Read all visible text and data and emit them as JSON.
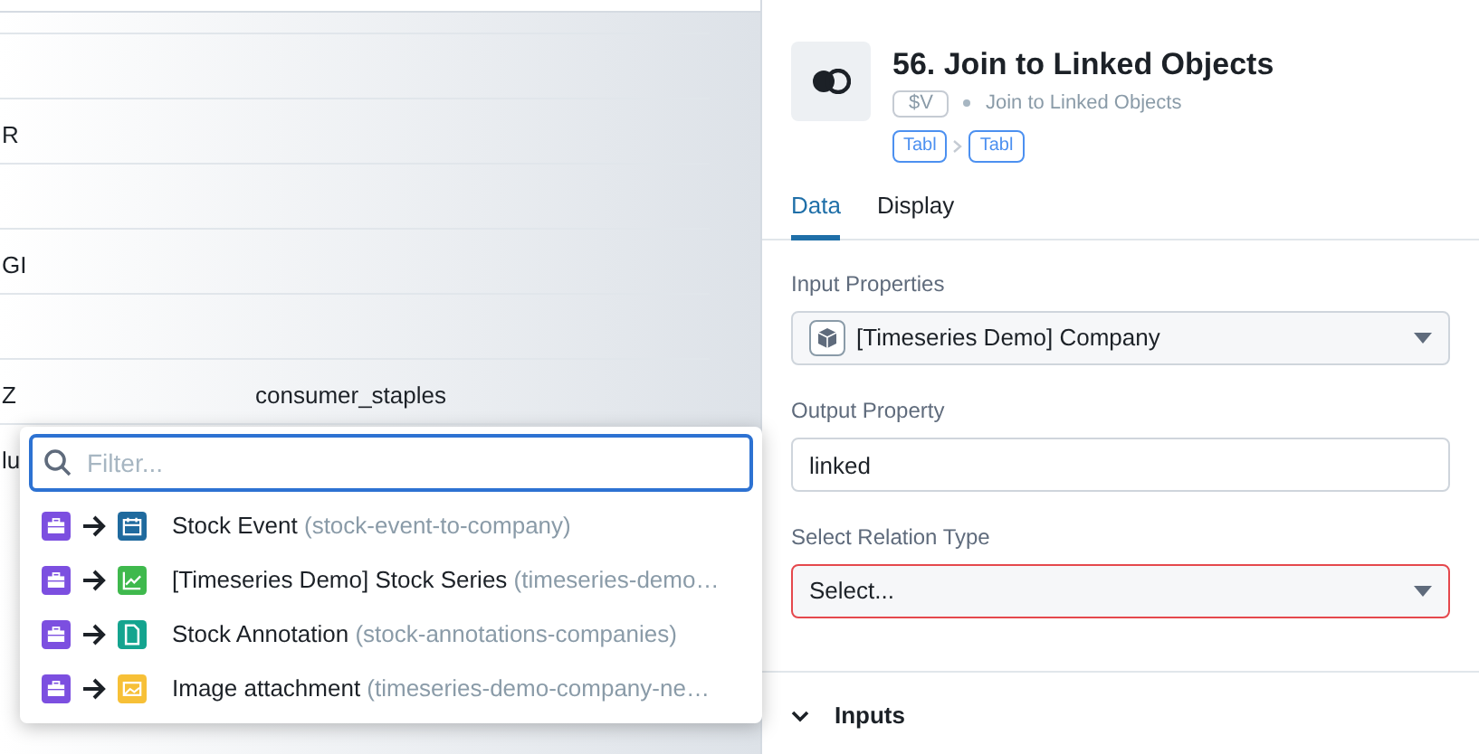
{
  "background_table": {
    "rows": [
      {
        "cells": []
      },
      {
        "cells": [
          "R"
        ]
      },
      {
        "cells": []
      },
      {
        "cells": [
          "GI"
        ]
      },
      {
        "cells": []
      },
      {
        "cells": [
          "Z",
          "consumer_staples"
        ]
      },
      {
        "cells": [
          "lu"
        ]
      }
    ]
  },
  "relation_menu": {
    "filter": {
      "placeholder": "Filter..."
    },
    "items": [
      {
        "name": "Stock Event",
        "id": "(stock-event-to-company)",
        "kind": "calendar",
        "color": "#1f6a9e"
      },
      {
        "name": "[Timeseries Demo] Stock Series",
        "id": "(timeseries-demo…",
        "kind": "chart",
        "color": "#3fb94d"
      },
      {
        "name": "Stock Annotation",
        "id": "(stock-annotations-companies)",
        "kind": "document",
        "color": "#14a48f"
      },
      {
        "name": "Image attachment",
        "id": "(timeseries-demo-company-ne…",
        "kind": "image",
        "color": "#f7c037"
      }
    ]
  },
  "panel": {
    "title": "56. Join to Linked Objects",
    "variable": "$V",
    "subtitle": "Join to Linked Objects",
    "types": [
      "Tabl",
      "Tabl"
    ],
    "tabs": [
      {
        "label": "Data",
        "selected": true
      },
      {
        "label": "Display",
        "selected": false
      }
    ],
    "fields": [
      {
        "kind": "select",
        "label": "Input Properties",
        "value": "[Timeseries Demo] Company",
        "error": false
      },
      {
        "kind": "text",
        "label": "Output Property",
        "value": "linked",
        "error": false
      },
      {
        "kind": "select",
        "label": "Select Relation Type",
        "value": "Select...",
        "error": true
      }
    ],
    "sections": [
      {
        "label": "Inputs",
        "expanded": true
      }
    ]
  }
}
